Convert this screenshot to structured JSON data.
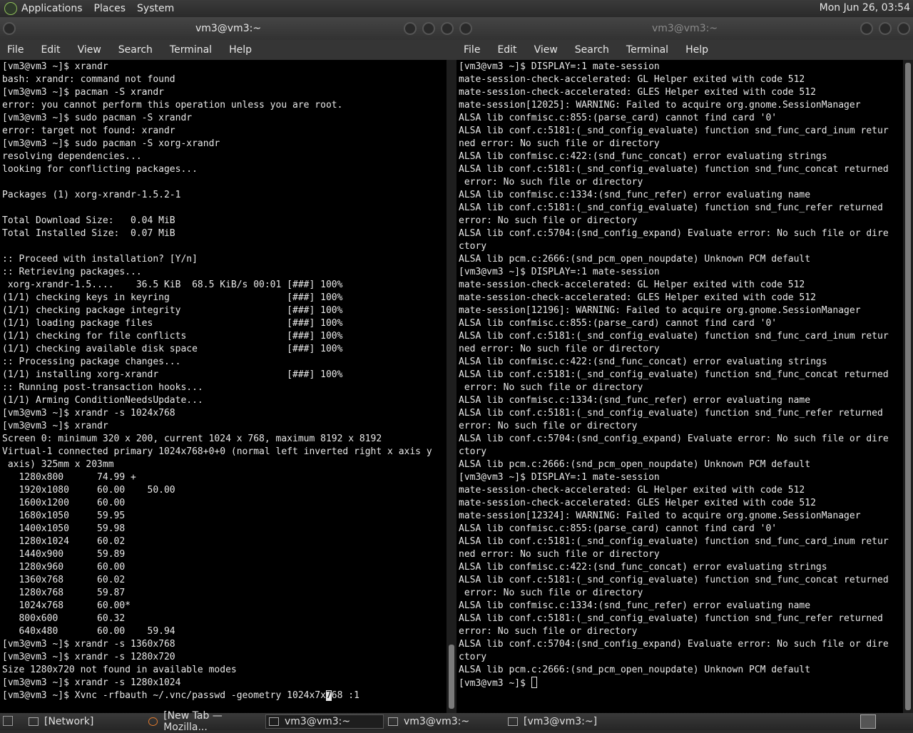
{
  "topbar": {
    "menus": [
      "Applications",
      "Places",
      "System"
    ],
    "clock": "Mon Jun 26, 03:54"
  },
  "left_window": {
    "title": "vm3@vm3:~",
    "menus": [
      "File",
      "Edit",
      "View",
      "Search",
      "Terminal",
      "Help"
    ],
    "lines": [
      "[vm3@vm3 ~]$ xrandr",
      "bash: xrandr: command not found",
      "[vm3@vm3 ~]$ pacman -S xrandr",
      "error: you cannot perform this operation unless you are root.",
      "[vm3@vm3 ~]$ sudo pacman -S xrandr",
      "error: target not found: xrandr",
      "[vm3@vm3 ~]$ sudo pacman -S xorg-xrandr",
      "resolving dependencies...",
      "looking for conflicting packages...",
      "",
      "Packages (1) xorg-xrandr-1.5.2-1",
      "",
      "Total Download Size:   0.04 MiB",
      "Total Installed Size:  0.07 MiB",
      "",
      ":: Proceed with installation? [Y/n]",
      ":: Retrieving packages...",
      " xorg-xrandr-1.5....    36.5 KiB  68.5 KiB/s 00:01 [###] 100%",
      "(1/1) checking keys in keyring                     [###] 100%",
      "(1/1) checking package integrity                   [###] 100%",
      "(1/1) loading package files                        [###] 100%",
      "(1/1) checking for file conflicts                  [###] 100%",
      "(1/1) checking available disk space                [###] 100%",
      ":: Processing package changes...",
      "(1/1) installing xorg-xrandr                       [###] 100%",
      ":: Running post-transaction hooks...",
      "(1/1) Arming ConditionNeedsUpdate...",
      "[vm3@vm3 ~]$ xrandr -s 1024x768",
      "[vm3@vm3 ~]$ xrandr",
      "Screen 0: minimum 320 x 200, current 1024 x 768, maximum 8192 x 8192",
      "Virtual-1 connected primary 1024x768+0+0 (normal left inverted right x axis y",
      " axis) 325mm x 203mm",
      "   1280x800      74.99 +",
      "   1920x1080     60.00    50.00",
      "   1600x1200     60.00",
      "   1680x1050     59.95",
      "   1400x1050     59.98",
      "   1280x1024     60.02",
      "   1440x900      59.89",
      "   1280x960      60.00",
      "   1360x768      60.02",
      "   1280x768      59.87",
      "   1024x768      60.00*",
      "   800x600       60.32",
      "   640x480       60.00    59.94",
      "[vm3@vm3 ~]$ xrandr -s 1360x768",
      "[vm3@vm3 ~]$ xrandr -s 1280x720",
      "Size 1280x720 not found in available modes",
      "[vm3@vm3 ~]$ xrandr -s 1280x1024"
    ],
    "last_line_before_cursor": "[vm3@vm3 ~]$ Xvnc -rfbauth ~/.vnc/passwd -geometry 1024x7x",
    "cursor_char": "7",
    "last_line_after_cursor": "68 :1"
  },
  "right_window": {
    "title": "vm3@vm3:~",
    "menus": [
      "File",
      "Edit",
      "View",
      "Search",
      "Terminal",
      "Help"
    ],
    "lines": [
      "[vm3@vm3 ~]$ DISPLAY=:1 mate-session",
      "mate-session-check-accelerated: GL Helper exited with code 512",
      "mate-session-check-accelerated: GLES Helper exited with code 512",
      "mate-session[12025]: WARNING: Failed to acquire org.gnome.SessionManager",
      "ALSA lib confmisc.c:855:(parse_card) cannot find card '0'",
      "ALSA lib conf.c:5181:(_snd_config_evaluate) function snd_func_card_inum retur",
      "ned error: No such file or directory",
      "ALSA lib confmisc.c:422:(snd_func_concat) error evaluating strings",
      "ALSA lib conf.c:5181:(_snd_config_evaluate) function snd_func_concat returned",
      " error: No such file or directory",
      "ALSA lib confmisc.c:1334:(snd_func_refer) error evaluating name",
      "ALSA lib conf.c:5181:(_snd_config_evaluate) function snd_func_refer returned",
      "error: No such file or directory",
      "ALSA lib conf.c:5704:(snd_config_expand) Evaluate error: No such file or dire",
      "ctory",
      "ALSA lib pcm.c:2666:(snd_pcm_open_noupdate) Unknown PCM default",
      "[vm3@vm3 ~]$ DISPLAY=:1 mate-session",
      "mate-session-check-accelerated: GL Helper exited with code 512",
      "mate-session-check-accelerated: GLES Helper exited with code 512",
      "mate-session[12196]: WARNING: Failed to acquire org.gnome.SessionManager",
      "ALSA lib confmisc.c:855:(parse_card) cannot find card '0'",
      "ALSA lib conf.c:5181:(_snd_config_evaluate) function snd_func_card_inum retur",
      "ned error: No such file or directory",
      "ALSA lib confmisc.c:422:(snd_func_concat) error evaluating strings",
      "ALSA lib conf.c:5181:(_snd_config_evaluate) function snd_func_concat returned",
      " error: No such file or directory",
      "ALSA lib confmisc.c:1334:(snd_func_refer) error evaluating name",
      "ALSA lib conf.c:5181:(_snd_config_evaluate) function snd_func_refer returned",
      "error: No such file or directory",
      "ALSA lib conf.c:5704:(snd_config_expand) Evaluate error: No such file or dire",
      "ctory",
      "ALSA lib pcm.c:2666:(snd_pcm_open_noupdate) Unknown PCM default",
      "[vm3@vm3 ~]$ DISPLAY=:1 mate-session",
      "mate-session-check-accelerated: GL Helper exited with code 512",
      "mate-session-check-accelerated: GLES Helper exited with code 512",
      "mate-session[12324]: WARNING: Failed to acquire org.gnome.SessionManager",
      "ALSA lib confmisc.c:855:(parse_card) cannot find card '0'",
      "ALSA lib conf.c:5181:(_snd_config_evaluate) function snd_func_card_inum retur",
      "ned error: No such file or directory",
      "ALSA lib confmisc.c:422:(snd_func_concat) error evaluating strings",
      "ALSA lib conf.c:5181:(_snd_config_evaluate) function snd_func_concat returned",
      " error: No such file or directory",
      "ALSA lib confmisc.c:1334:(snd_func_refer) error evaluating name",
      "ALSA lib conf.c:5181:(_snd_config_evaluate) function snd_func_refer returned",
      "error: No such file or directory",
      "ALSA lib conf.c:5704:(snd_config_expand) Evaluate error: No such file or dire",
      "ctory",
      "ALSA lib pcm.c:2666:(snd_pcm_open_noupdate) Unknown PCM default"
    ],
    "prompt": "[vm3@vm3 ~]$ "
  },
  "taskbar": {
    "tasks": [
      {
        "label": "[Network]",
        "icon": "folder-icon"
      },
      {
        "label": "[New Tab — Mozilla...",
        "icon": "firefox-icon"
      },
      {
        "label": "vm3@vm3:~",
        "icon": "terminal-icon"
      },
      {
        "label": "vm3@vm3:~",
        "icon": "terminal-icon"
      },
      {
        "label": "[vm3@vm3:~]",
        "icon": "terminal-icon"
      }
    ]
  }
}
